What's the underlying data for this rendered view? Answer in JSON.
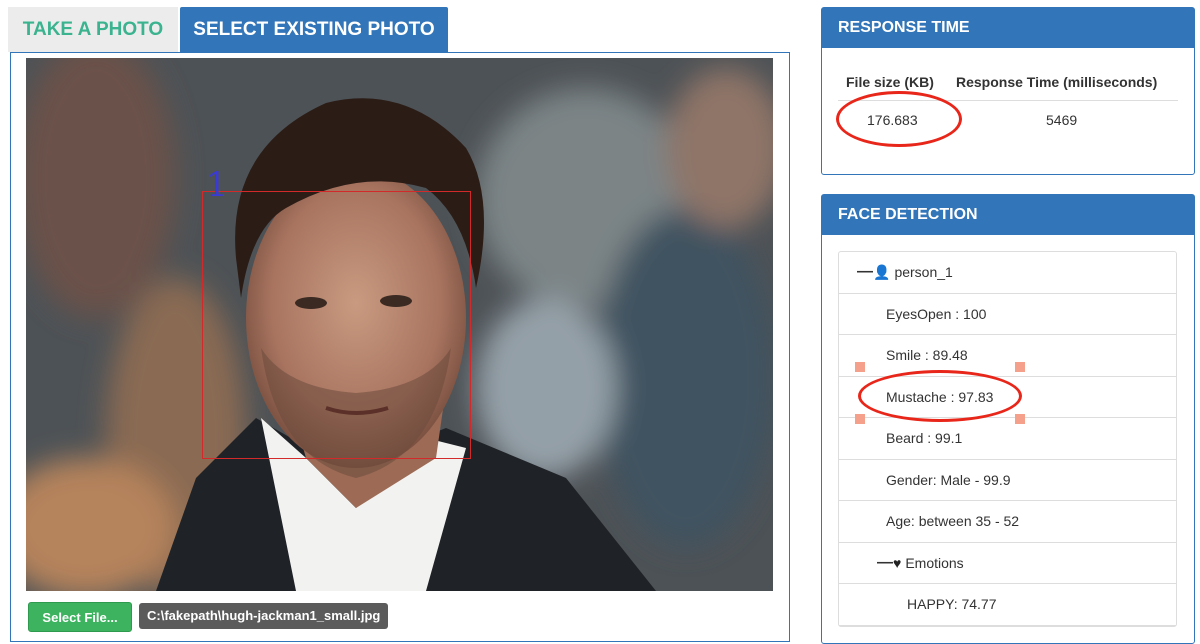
{
  "tabs": [
    {
      "label": "TAKE A PHOTO",
      "active": false
    },
    {
      "label": "SELECT EXISTING PHOTO",
      "active": true
    }
  ],
  "photo": {
    "face_label": "1",
    "select_button": "Select File...",
    "file_path": "C:\\fakepath\\hugh-jackman1_small.jpg"
  },
  "response_time": {
    "header": "RESPONSE TIME",
    "columns": [
      "File size (KB)",
      "Response Time (milliseconds)"
    ],
    "row": [
      "176.683",
      "5469"
    ]
  },
  "face_detection": {
    "header": "FACE DETECTION",
    "person": {
      "label": "person_1",
      "toggle_icon": "minus-icon",
      "icon": "user-icon"
    },
    "attributes": [
      "EyesOpen : 100",
      "Smile : 89.48",
      "Mustache : 97.83",
      "Beard : 99.1",
      "Gender: Male - 99.9",
      "Age: between 35 - 52"
    ],
    "emotions": {
      "label": "Emotions",
      "toggle_icon": "minus-icon",
      "icon": "heart-icon"
    },
    "emotion_items": [
      "HAPPY: 74.77"
    ]
  },
  "colors": {
    "accent": "#3275b8",
    "green": "#3db35f",
    "annotation_red": "#e8261a",
    "face_box": "#d22a2a"
  }
}
